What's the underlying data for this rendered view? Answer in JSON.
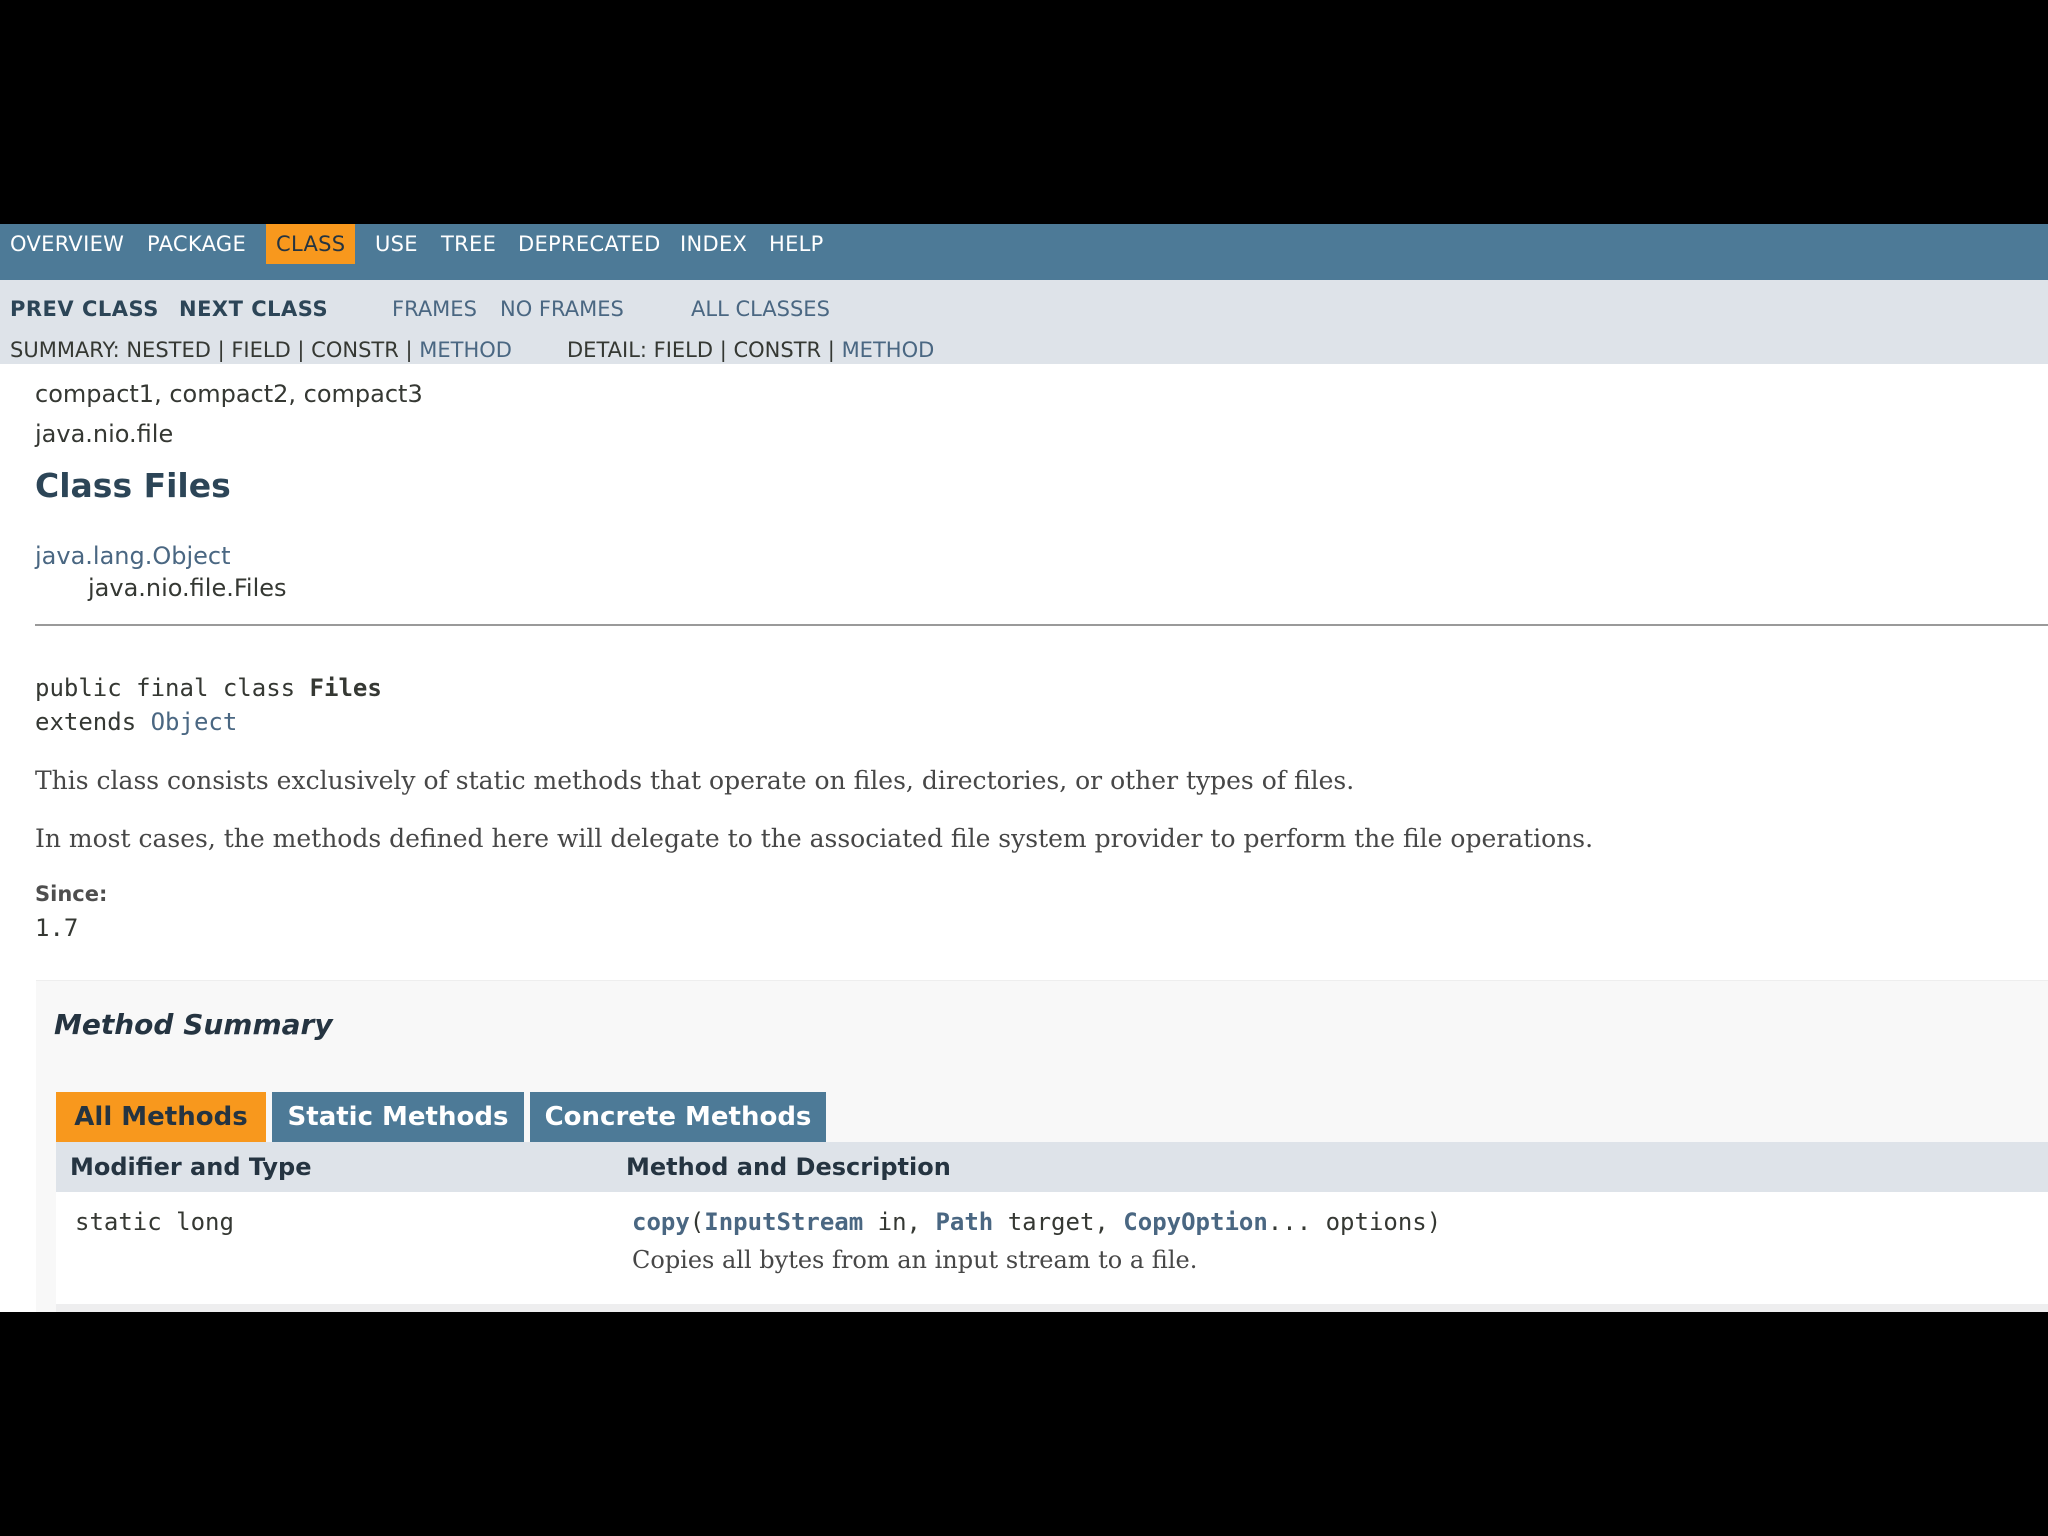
{
  "nav": {
    "top": [
      "OVERVIEW",
      "PACKAGE",
      "CLASS",
      "USE",
      "TREE",
      "DEPRECATED",
      "INDEX",
      "HELP"
    ],
    "prev_class": "PREV CLASS",
    "next_class": "NEXT CLASS",
    "frames": "FRAMES",
    "no_frames": "NO FRAMES",
    "all_classes": "ALL CLASSES",
    "summary_label": "SUMMARY: NESTED | FIELD | CONSTR | ",
    "summary_method": "METHOD",
    "detail_label": "DETAIL: FIELD | CONSTR | ",
    "detail_method": "METHOD"
  },
  "header": {
    "profiles": "compact1, compact2, compact3",
    "package": "java.nio.file",
    "title": "Class Files"
  },
  "inheritance": {
    "parent": "java.lang.Object",
    "child": "java.nio.file.Files"
  },
  "declaration": {
    "line1_prefix": "public final class ",
    "line1_name": "Files",
    "line2_prefix": "extends ",
    "line2_link": "Object"
  },
  "description": {
    "p1": "This class consists exclusively of static methods that operate on files, directories, or other types of files.",
    "p2": "In most cases, the methods defined here will delegate to the associated file system provider to perform the file operations.",
    "since_label": "Since:",
    "since_value": "1.7"
  },
  "method_summary": {
    "title": "Method Summary",
    "tabs": [
      "All Methods",
      "Static Methods",
      "Concrete Methods"
    ],
    "col_modifier": "Modifier and Type",
    "col_method": "Method and Description",
    "rows": [
      {
        "modifier": "static long",
        "method_name": "copy",
        "sig_open": "(",
        "p1_type": "InputStream",
        "p1_rest": " in, ",
        "p2_type": "Path",
        "p2_rest": " target, ",
        "p3_type": "CopyOption",
        "p3_rest": "... options)",
        "description": "Copies all bytes from an input stream to a file."
      }
    ]
  },
  "colors": {
    "nav_bg": "#4D7A97",
    "active_tab": "#F8981D",
    "subnav_bg": "#DEE3E9",
    "link": "#4A6782"
  }
}
